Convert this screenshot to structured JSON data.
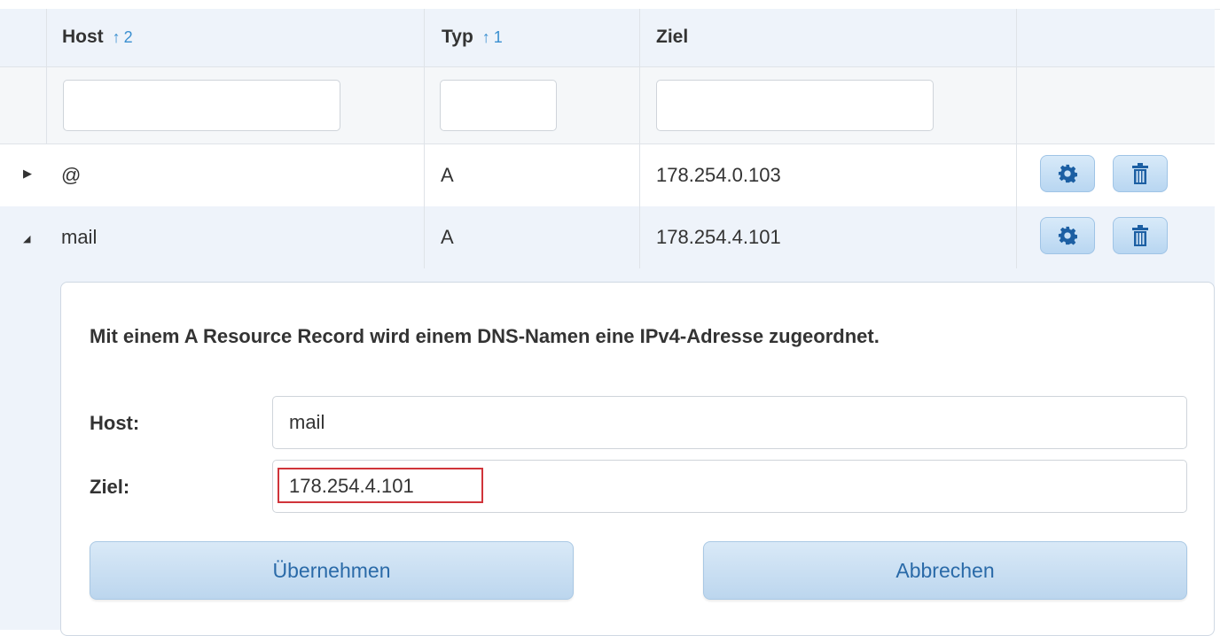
{
  "table": {
    "columns": [
      {
        "label": "Host",
        "sort": "2"
      },
      {
        "label": "Typ",
        "sort": "1"
      },
      {
        "label": "Ziel",
        "sort": ""
      }
    ],
    "filters": {
      "host": "",
      "typ": "",
      "ziel": ""
    },
    "rows": [
      {
        "host": "@",
        "typ": "A",
        "ziel": "178.254.0.103",
        "expanded": false
      },
      {
        "host": "mail",
        "typ": "A",
        "ziel": "178.254.4.101",
        "expanded": true
      }
    ]
  },
  "detail": {
    "description": "Mit einem A Resource Record wird einem DNS-Namen eine IPv4-Adresse zugeordnet.",
    "host_label": "Host:",
    "host_value": "mail",
    "ziel_label": "Ziel:",
    "ziel_value": "178.254.4.101",
    "apply_label": "Übernehmen",
    "cancel_label": "Abbrechen"
  },
  "icons": {
    "sort": "sort-ascending-arrow-icon",
    "expand": "triangle-right-icon",
    "collapse": "triangle-down-icon",
    "edit": "gear-icon",
    "delete": "trash-icon"
  },
  "colors": {
    "accent": "#3a8fd0",
    "header_bg": "#eef3fa",
    "highlight": "#d0343a",
    "button_text": "#2a6aa8"
  }
}
